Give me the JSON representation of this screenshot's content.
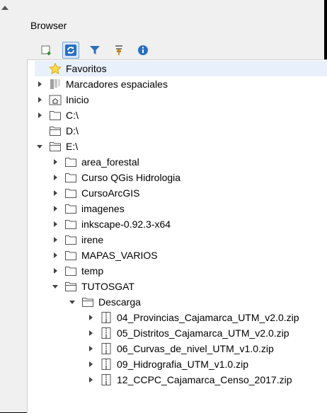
{
  "panel": {
    "title": "Browser"
  },
  "toolbar": {
    "items": [
      "add-layer-icon",
      "refresh-icon",
      "filter-icon",
      "collapse-all-icon",
      "info-icon"
    ]
  },
  "tree": {
    "items": [
      {
        "label": "Favoritos",
        "level": 0,
        "expander": "none",
        "icon": "star-icon"
      },
      {
        "label": "Marcadores espaciales",
        "level": 0,
        "expander": "right",
        "icon": "bookmarks-icon"
      },
      {
        "label": "Inicio",
        "level": 0,
        "expander": "right",
        "icon": "home-folder-icon"
      },
      {
        "label": "C:\\",
        "level": 0,
        "expander": "right",
        "icon": "folder-icon"
      },
      {
        "label": "D:\\",
        "level": 0,
        "expander": "none",
        "icon": "folder-open-icon"
      },
      {
        "label": "E:\\",
        "level": 0,
        "expander": "down",
        "icon": "folder-open-icon"
      },
      {
        "label": "area_forestal",
        "level": 1,
        "expander": "right",
        "icon": "folder-icon"
      },
      {
        "label": "Curso QGis Hidrologia",
        "level": 1,
        "expander": "right",
        "icon": "folder-icon"
      },
      {
        "label": "CursoArcGIS",
        "level": 1,
        "expander": "right",
        "icon": "folder-icon"
      },
      {
        "label": "imagenes",
        "level": 1,
        "expander": "right",
        "icon": "folder-icon"
      },
      {
        "label": "inkscape-0.92.3-x64",
        "level": 1,
        "expander": "right",
        "icon": "folder-icon"
      },
      {
        "label": "irene",
        "level": 1,
        "expander": "right",
        "icon": "folder-icon"
      },
      {
        "label": "MAPAS_VARIOS",
        "level": 1,
        "expander": "right",
        "icon": "folder-icon"
      },
      {
        "label": "temp",
        "level": 1,
        "expander": "right",
        "icon": "folder-icon"
      },
      {
        "label": "TUTOSGAT",
        "level": 1,
        "expander": "down",
        "icon": "folder-open-icon"
      },
      {
        "label": "Descarga",
        "level": 2,
        "expander": "down",
        "icon": "folder-open-icon"
      },
      {
        "label": "04_Provincias_Cajamarca_UTM_v2.0.zip",
        "level": 3,
        "expander": "right",
        "icon": "zip-icon"
      },
      {
        "label": "05_Distritos_Cajamarca_UTM_v2.0.zip",
        "level": 3,
        "expander": "right",
        "icon": "zip-icon"
      },
      {
        "label": "06_Curvas_de_nivel_UTM_v1.0.zip",
        "level": 3,
        "expander": "right",
        "icon": "zip-icon"
      },
      {
        "label": "09_Hidrografia_UTM_v1.0.zip",
        "level": 3,
        "expander": "right",
        "icon": "zip-icon"
      },
      {
        "label": "12_CCPC_Cajamarca_Censo_2017.zip",
        "level": 3,
        "expander": "right",
        "icon": "zip-icon"
      }
    ]
  }
}
